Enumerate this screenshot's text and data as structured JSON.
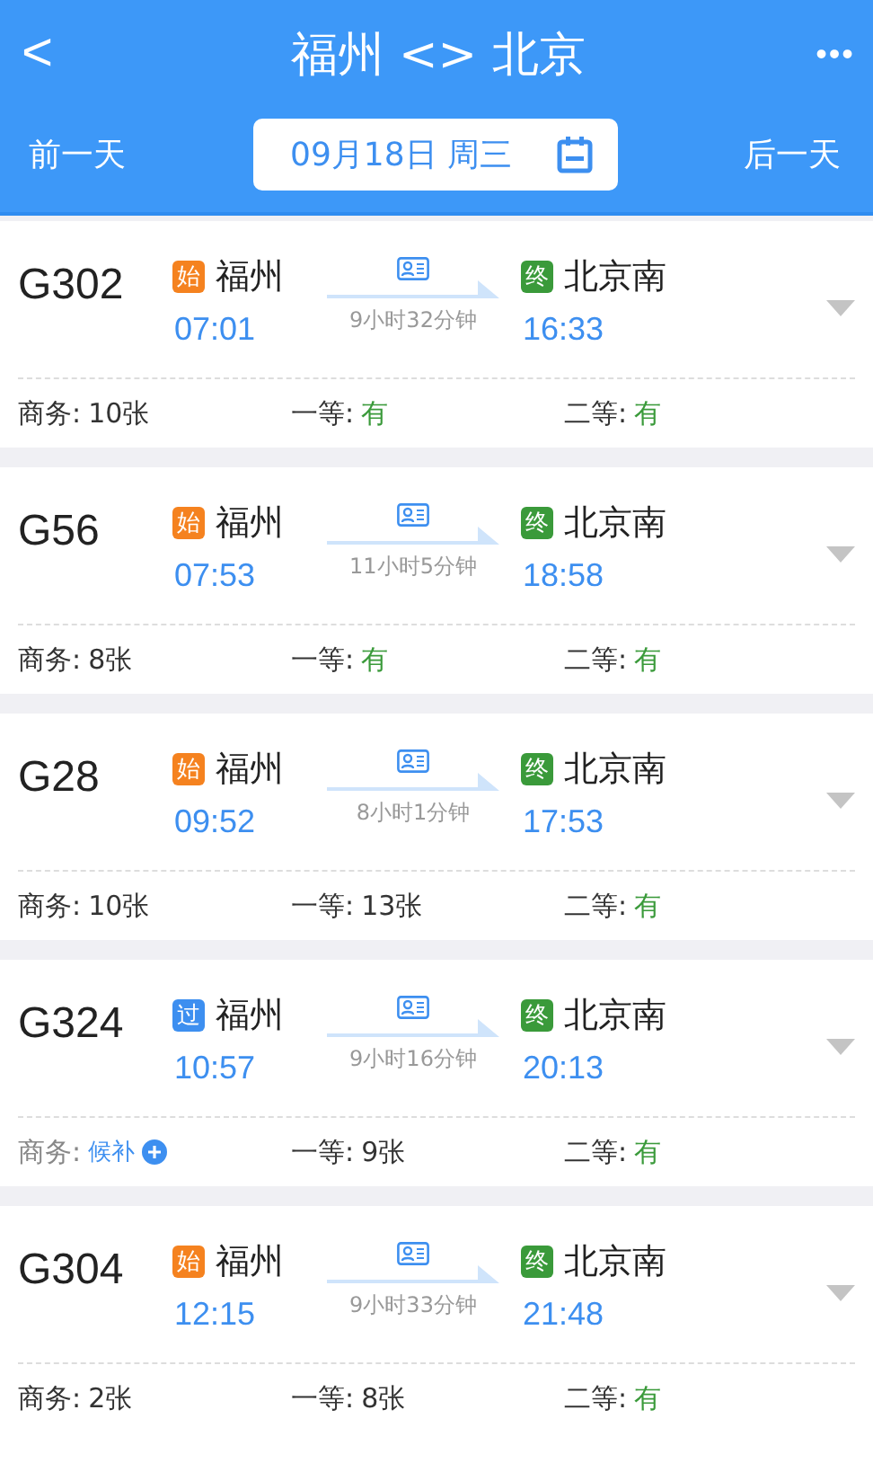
{
  "header": {
    "back": "<",
    "title": "福州 <> 北京",
    "more": "•••",
    "prev_day": "前一天",
    "date": "09月18日 周三",
    "next_day": "后一天"
  },
  "trains": [
    {
      "number": "G302",
      "from": {
        "tag": "始",
        "color": "#f5821f",
        "name": "福州",
        "time": "07:01"
      },
      "duration": "9小时32分钟",
      "to": {
        "tag": "终",
        "color": "#3a9a3a",
        "name": "北京南",
        "time": "16:33"
      },
      "seats": [
        {
          "label": "商务:",
          "kind": "count",
          "value": "10张"
        },
        {
          "label": "一等:",
          "kind": "available",
          "value": "有"
        },
        {
          "label": "二等:",
          "kind": "available",
          "value": "有"
        }
      ]
    },
    {
      "number": "G56",
      "from": {
        "tag": "始",
        "color": "#f5821f",
        "name": "福州",
        "time": "07:53"
      },
      "duration": "11小时5分钟",
      "to": {
        "tag": "终",
        "color": "#3a9a3a",
        "name": "北京南",
        "time": "18:58"
      },
      "seats": [
        {
          "label": "商务:",
          "kind": "count",
          "value": "8张"
        },
        {
          "label": "一等:",
          "kind": "available",
          "value": "有"
        },
        {
          "label": "二等:",
          "kind": "available",
          "value": "有"
        }
      ]
    },
    {
      "number": "G28",
      "from": {
        "tag": "始",
        "color": "#f5821f",
        "name": "福州",
        "time": "09:52"
      },
      "duration": "8小时1分钟",
      "to": {
        "tag": "终",
        "color": "#3a9a3a",
        "name": "北京南",
        "time": "17:53"
      },
      "seats": [
        {
          "label": "商务:",
          "kind": "count",
          "value": "10张"
        },
        {
          "label": "一等:",
          "kind": "count",
          "value": "13张"
        },
        {
          "label": "二等:",
          "kind": "available",
          "value": "有"
        }
      ]
    },
    {
      "number": "G324",
      "from": {
        "tag": "过",
        "color": "#3d8ff0",
        "name": "福州",
        "time": "10:57"
      },
      "duration": "9小时16分钟",
      "to": {
        "tag": "终",
        "color": "#3a9a3a",
        "name": "北京南",
        "time": "20:13"
      },
      "seats": [
        {
          "label": "商务:",
          "kind": "waitlist",
          "value": "候补"
        },
        {
          "label": "一等:",
          "kind": "count",
          "value": "9张"
        },
        {
          "label": "二等:",
          "kind": "available",
          "value": "有"
        }
      ]
    },
    {
      "number": "G304",
      "from": {
        "tag": "始",
        "color": "#f5821f",
        "name": "福州",
        "time": "12:15"
      },
      "duration": "9小时33分钟",
      "to": {
        "tag": "终",
        "color": "#3a9a3a",
        "name": "北京南",
        "time": "21:48"
      },
      "seats": [
        {
          "label": "商务:",
          "kind": "count",
          "value": "2张"
        },
        {
          "label": "一等:",
          "kind": "count",
          "value": "8张"
        },
        {
          "label": "二等:",
          "kind": "available",
          "value": "有"
        }
      ]
    }
  ]
}
